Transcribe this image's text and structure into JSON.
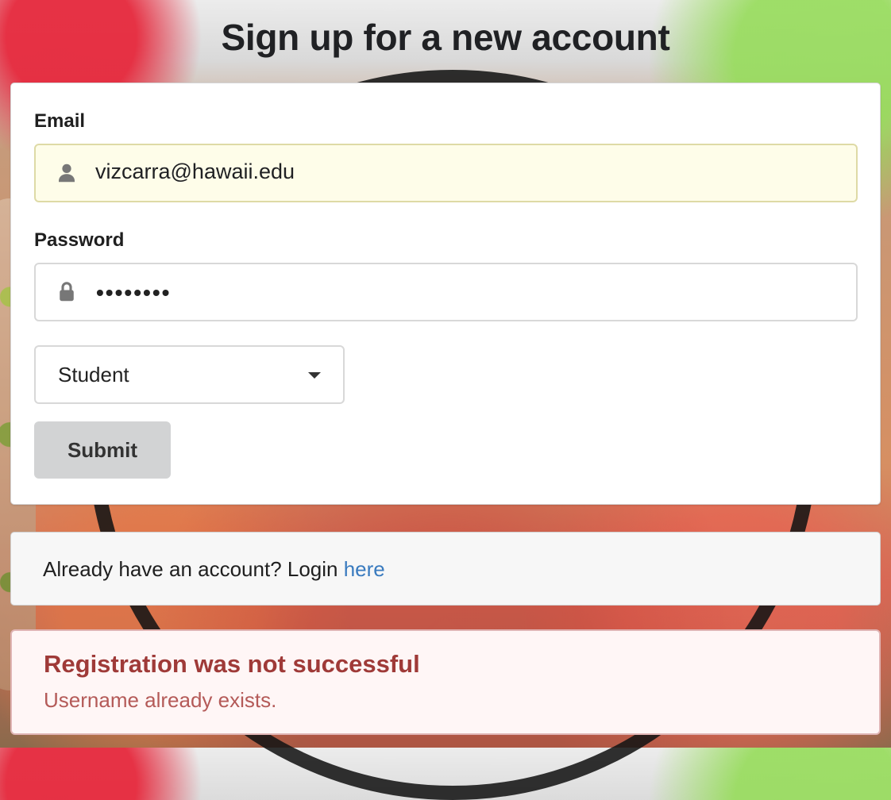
{
  "page": {
    "title": "Sign up for a new account"
  },
  "signup_form": {
    "email_label": "Email",
    "email_value": "vizcarra@hawaii.edu",
    "email_icon": "user-icon",
    "password_label": "Password",
    "password_value": "••••••••",
    "password_icon": "lock-icon",
    "role_value": "Student",
    "dropdown_icon": "chevron-down-icon",
    "submit_label": "Submit"
  },
  "login_prompt": {
    "text": "Already have an account? Login ",
    "link_text": "here"
  },
  "error_message": {
    "title": "Registration was not successful",
    "message": "Username already exists."
  },
  "colors": {
    "input_highlight": "#fefde9",
    "link": "#3a7bbf",
    "error_title": "#9f3a38",
    "error_text": "#b45a58",
    "error_background": "#fff6f6"
  }
}
